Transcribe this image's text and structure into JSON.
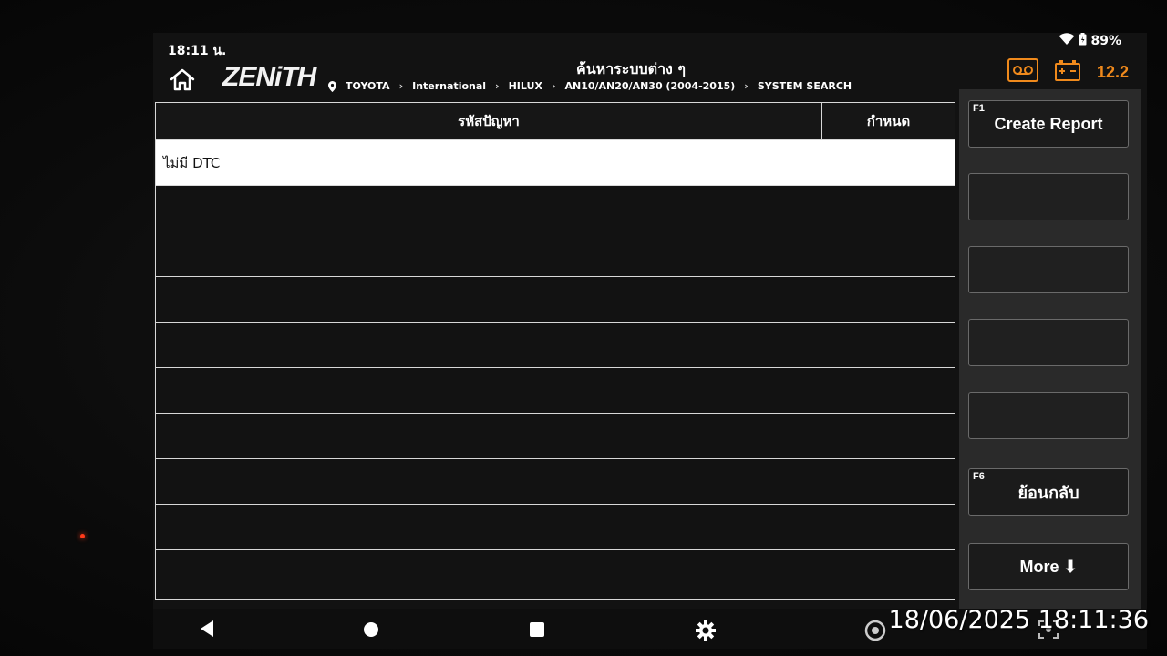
{
  "status_bar": {
    "time": "18:11 น.",
    "battery_percent": "89%"
  },
  "header": {
    "logo": "ZENiTH",
    "title": "ค้นหาระบบต่าง ๆ",
    "breadcrumb": [
      "TOYOTA",
      "International",
      "HILUX",
      "AN10/AN20/AN30 (2004-2015)",
      "SYSTEM SEARCH"
    ],
    "voltage": "12.2",
    "accent_color": "#f08a1c"
  },
  "dtc_table": {
    "columns": [
      "รหัสปัญหา",
      "กำหนด"
    ],
    "rows": [
      [
        "ไม่มี DTC",
        ""
      ],
      [
        "",
        ""
      ],
      [
        "",
        ""
      ],
      [
        "",
        ""
      ],
      [
        "",
        ""
      ],
      [
        "",
        ""
      ],
      [
        "",
        ""
      ],
      [
        "",
        ""
      ],
      [
        "",
        ""
      ],
      [
        "",
        ""
      ]
    ]
  },
  "function_keys": [
    {
      "key": "F1",
      "label": "Create Report"
    },
    {
      "key": "",
      "label": ""
    },
    {
      "key": "",
      "label": ""
    },
    {
      "key": "",
      "label": ""
    },
    {
      "key": "",
      "label": ""
    },
    {
      "key": "F6",
      "label": "ย้อนกลับ"
    },
    {
      "key": "",
      "label": "More ⬇"
    }
  ],
  "nav_bar": [
    "back-icon",
    "home-icon",
    "recents-icon",
    "settings-icon",
    "browser-icon",
    "screenshot-icon"
  ],
  "camera_timestamp": "18/06/2025 18:11:36"
}
